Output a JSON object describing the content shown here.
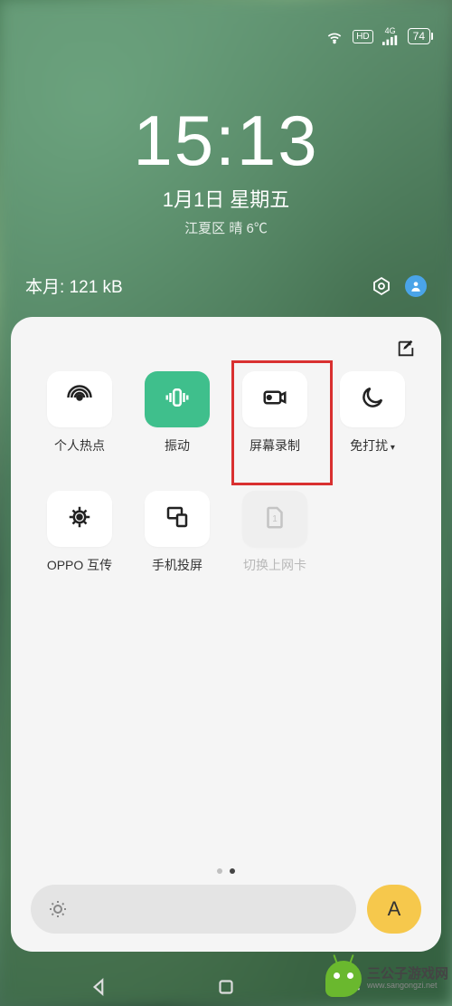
{
  "status": {
    "hd": "HD",
    "network": "4G",
    "battery": "74"
  },
  "lock": {
    "time": "15:13",
    "date": "1月1日 星期五",
    "weather": "江夏区 晴 6℃"
  },
  "midbar": {
    "month_label": "本月:",
    "data_usage": "121 kB"
  },
  "panel": {
    "tiles": [
      {
        "name": "hotspot",
        "label": "个人热点",
        "active": false
      },
      {
        "name": "vibrate",
        "label": "振动",
        "active": true
      },
      {
        "name": "screen-record",
        "label": "屏幕录制",
        "active": false
      },
      {
        "name": "dnd",
        "label": "免打扰",
        "dropdown": true,
        "active": false
      },
      {
        "name": "oppo-share",
        "label": "OPPO 互传",
        "active": false
      },
      {
        "name": "screen-cast",
        "label": "手机投屏",
        "active": false
      },
      {
        "name": "sim-switch",
        "label": "切换上网卡",
        "disabled": true,
        "active": false
      }
    ],
    "highlighted": "screen-record",
    "page_count": 2,
    "page_active": 1,
    "auto_brightness": "A"
  },
  "watermark": {
    "cn": "三公子游戏网",
    "url": "www.sangongzi.net"
  },
  "colors": {
    "accent_green": "#3fbf8c",
    "highlight_red": "#d93030",
    "chip_yellow": "#f6c84c",
    "avatar_blue": "#4aa4e8",
    "android_green": "#6ab82e"
  }
}
